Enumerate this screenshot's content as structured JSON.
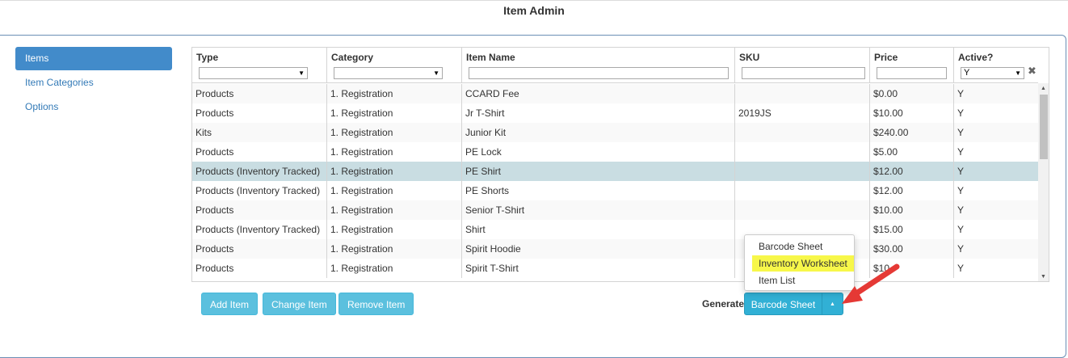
{
  "title": "Item Admin",
  "sidebar": {
    "items": [
      {
        "label": "Items",
        "active": true
      },
      {
        "label": "Item Categories",
        "active": false
      },
      {
        "label": "Options",
        "active": false
      }
    ]
  },
  "grid": {
    "columns": [
      "Type",
      "Category",
      "Item Name",
      "SKU",
      "Price",
      "Active?"
    ],
    "filters": {
      "active_value": "Y"
    },
    "rows": [
      [
        "Products",
        "1. Registration",
        "CCARD Fee",
        "",
        "$0.00",
        "Y"
      ],
      [
        "Products",
        "1. Registration",
        "Jr T-Shirt",
        "2019JS",
        "$10.00",
        "Y"
      ],
      [
        "Kits",
        "1. Registration",
        "Junior Kit",
        "",
        "$240.00",
        "Y"
      ],
      [
        "Products",
        "1. Registration",
        "PE Lock",
        "",
        "$5.00",
        "Y"
      ],
      [
        "Products (Inventory Tracked)",
        "1. Registration",
        "PE Shirt",
        "",
        "$12.00",
        "Y"
      ],
      [
        "Products (Inventory Tracked)",
        "1. Registration",
        "PE Shorts",
        "",
        "$12.00",
        "Y"
      ],
      [
        "Products",
        "1. Registration",
        "Senior T-Shirt",
        "",
        "$10.00",
        "Y"
      ],
      [
        "Products (Inventory Tracked)",
        "1. Registration",
        "Shirt",
        "",
        "$15.00",
        "Y"
      ],
      [
        "Products",
        "1. Registration",
        "Spirit Hoodie",
        "",
        "$30.00",
        "Y"
      ],
      [
        "Products",
        "1. Registration",
        "Spirit T-Shirt",
        "",
        "$10.",
        "Y"
      ]
    ],
    "selected_row_index": 4
  },
  "actions": {
    "add": "Add Item",
    "change": "Change Item",
    "remove": "Remove Item",
    "generate_label": "Generate",
    "generate_selected": "Barcode Sheet",
    "generate_options": [
      "Barcode Sheet",
      "Inventory Worksheet",
      "Item List"
    ],
    "highlighted_option": "Inventory Worksheet"
  },
  "icons": {
    "clear_filter": "close-icon",
    "dropdown_caret": "caret-up-icon",
    "annotation": "red-arrow"
  },
  "colors": {
    "primary": "#428bca",
    "info": "#5bc0de",
    "selected_row": "#c9dde2",
    "highlight": "#f7f74a",
    "arrow": "#e53935"
  }
}
